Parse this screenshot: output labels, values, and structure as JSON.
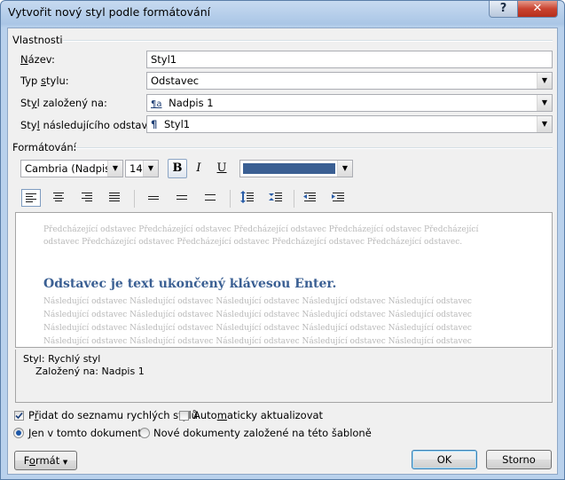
{
  "window": {
    "title": "Vytvořit nový styl podle formátování",
    "help_label": "?",
    "close_label": "✕"
  },
  "properties": {
    "section_label": "Vlastnosti",
    "name_label_u": "N",
    "name_label_rest": "ázev:",
    "name_value": "Styl1",
    "type_label_pre": "Typ ",
    "type_label_u": "s",
    "type_label_rest": "tylu:",
    "type_value": "Odstavec",
    "based_label_pre": "St",
    "based_label_u": "y",
    "based_label_rest": "l založený na:",
    "based_icon": "¶a",
    "based_value": "Nadpis 1",
    "next_label_pre": "Sty",
    "next_label_u": "l",
    "next_label_rest": " následujícího odstavce:",
    "next_icon": "¶",
    "next_value": "Styl1"
  },
  "formatting": {
    "section_label": "Formátování",
    "font": "Cambria (Nadpisy)",
    "size": "14",
    "bold": "B",
    "italic": "I",
    "underline": "U",
    "font_color": "#3a5f93"
  },
  "preview": {
    "previous_text": "Předcházející odstavec Předcházející odstavec Předcházející odstavec Předcházející odstavec Předcházející odstavec Předcházející odstavec Předcházející odstavec Předcházející odstavec Předcházející odstavec.",
    "sample_text": "Odstavec je text ukončený klávesou Enter.",
    "sample_color": "#3a5f93",
    "following_lines": [
      "Následující odstavec Následující odstavec Následující odstavec Následující odstavec Následující odstavec",
      "Následující odstavec Následující odstavec Následující odstavec Následující odstavec Následující odstavec",
      "Následující odstavec Následující odstavec Následující odstavec Následující odstavec Následující odstavec",
      "Následující odstavec Následující odstavec Následující odstavec Následující odstavec Následující odstavec"
    ]
  },
  "description": {
    "line1": "Styl: Rychlý styl",
    "line2": "Založený na: Nadpis 1"
  },
  "options": {
    "quick_style_pre": "P",
    "quick_style_u": "ř",
    "quick_style_rest": "idat do seznamu rychlých stylů",
    "auto_update_pre": "Auto",
    "auto_update_u": "m",
    "auto_update_rest": "aticky aktualizovat",
    "only_doc_u": "J",
    "only_doc_rest": "en v tomto dokumentu",
    "new_docs": "Nové dokumenty založené na této šabloně"
  },
  "buttons": {
    "format_u": "o",
    "format_pre": "F",
    "format_rest": "rmát",
    "ok": "OK",
    "cancel": "Storno"
  }
}
